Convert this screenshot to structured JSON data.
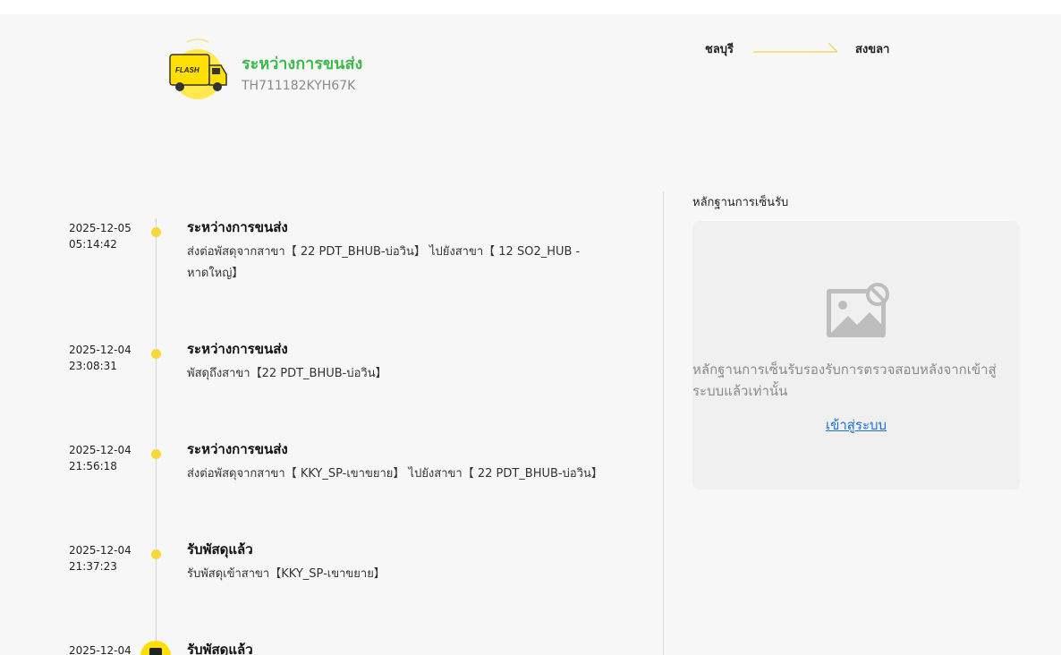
{
  "header": {
    "status_title": "ระหว่างการขนส่ง",
    "tracking_number": "TH711182KYH67K",
    "logo_text": "FLASH",
    "route_from": "ชลบุรี",
    "route_to": "สงขลา"
  },
  "colors": {
    "status_green": "#3dbb4a",
    "accent_yellow": "#ffde00",
    "link_blue": "#1f6fd6"
  },
  "timeline": [
    {
      "date": "2025-12-05",
      "time": "05:14:42",
      "title": "ระหว่างการขนส่ง",
      "desc": "ส่งต่อพัสดุจากสาขา【 22 PDT_BHUB-บ่อวิน】 ไปยังสาขา【 12 SO2_HUB - หาดใหญ่】"
    },
    {
      "date": "2025-12-04",
      "time": "23:08:31",
      "title": "ระหว่างการขนส่ง",
      "desc": "พัสดุถึงสาขา【22 PDT_BHUB-บ่อวิน】"
    },
    {
      "date": "2025-12-04",
      "time": "21:56:18",
      "title": "ระหว่างการขนส่ง",
      "desc": "ส่งต่อพัสดุจากสาขา【 KKY_SP-เขาขยาย】 ไปยังสาขา【 22 PDT_BHUB-บ่อวิน】"
    },
    {
      "date": "2025-12-04",
      "time": "21:37:23",
      "title": "รับพัสดุแล้ว",
      "desc": "รับพัสดุเข้าสาขา【KKY_SP-เขาขยาย】"
    },
    {
      "date": "2025-12-04",
      "time": "",
      "title": "รับพัสดุแล้ว",
      "desc": ""
    }
  ],
  "proof": {
    "heading": "หลักฐานการเซ็นรับ",
    "message": "หลักฐานการเซ็นรับรองรับการตรวจสอบหลังจากเข้าสู่ระบบแล้วเท่านั้น",
    "login_label": "เข้าสู่ระบบ",
    "icon": "image-unavailable-icon"
  }
}
